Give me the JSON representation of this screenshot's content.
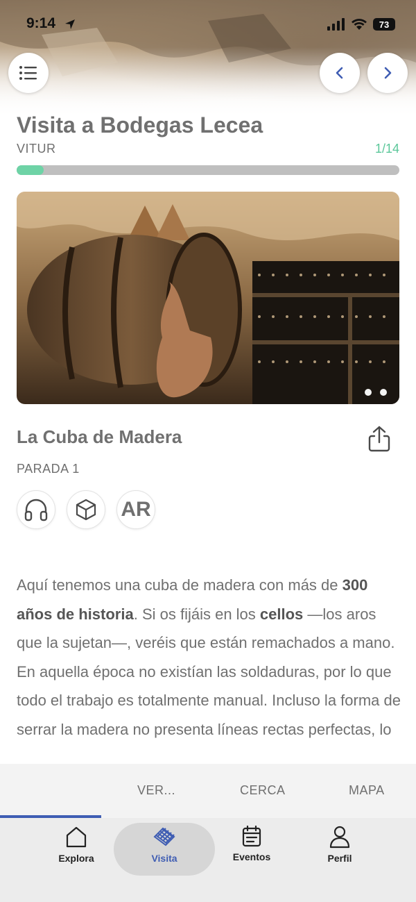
{
  "status_bar": {
    "time": "9:14",
    "battery": "73"
  },
  "header": {
    "title": "Visita a Bodegas Lecea",
    "subtitle": "VITUR",
    "progress_text": "1/14",
    "progress": 0.07
  },
  "stop": {
    "title": "La Cuba de Madera",
    "label": "PARADA 1",
    "ar_label": "AR"
  },
  "description": {
    "p1": "Aquí tenemos una cuba de madera con más de ",
    "b1": "300 años de historia",
    "p2": ". Si os fijáis en los ",
    "b2": "cellos",
    "p3": " —los aros que la sujetan—, veréis que están remachados a mano. En aquella época no existían las soldaduras, por lo que todo el trabajo es totalmente manual. Incluso la forma de serrar la madera no presenta líneas rectas perfectas, lo"
  },
  "subnav": {
    "items": [
      "VER...",
      "CERCA",
      "MAPA"
    ]
  },
  "tabbar": {
    "items": [
      {
        "label": "Explora",
        "icon": "home-icon"
      },
      {
        "label": "Visita",
        "icon": "visit-icon"
      },
      {
        "label": "Eventos",
        "icon": "calendar-icon"
      },
      {
        "label": "Perfil",
        "icon": "user-icon"
      }
    ]
  },
  "colors": {
    "accent": "#3f5db3",
    "progress": "#6ed3a6",
    "progress_text": "#5bc79a"
  }
}
